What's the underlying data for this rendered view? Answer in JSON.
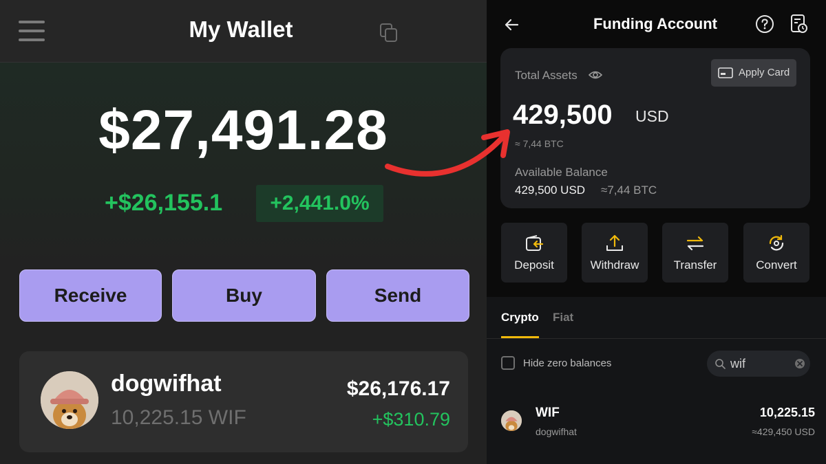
{
  "left_app": {
    "title": "My Wallet",
    "balance": "$27,491.28",
    "gain_amount": "+$26,155.1",
    "gain_percent": "+2,441.0%",
    "buttons": {
      "receive": "Receive",
      "buy": "Buy",
      "send": "Send"
    },
    "token": {
      "name": "dogwifhat",
      "amount": "10,225.15 WIF",
      "usd_value": "$26,176.17",
      "change": "+$310.79"
    }
  },
  "right_app": {
    "title": "Funding Account",
    "total_assets_label": "Total Assets",
    "apply_card_label": "Apply Card",
    "total_amount": "429,500",
    "total_unit": "USD",
    "btc_approx": "≈ 7,44 BTC",
    "available_label": "Available Balance",
    "available_usd": "429,500 USD",
    "available_btc": "≈7,44 BTC",
    "actions": {
      "deposit": "Deposit",
      "withdraw": "Withdraw",
      "transfer": "Transfer",
      "convert": "Convert"
    },
    "tabs": {
      "crypto": "Crypto",
      "fiat": "Fiat"
    },
    "hide_zero_label": "Hide zero balances",
    "search_value": "wif",
    "coin": {
      "symbol": "WIF",
      "name": "dogwifhat",
      "amount": "10,225.15",
      "usd_value": "≈429,450 USD"
    }
  },
  "colors": {
    "gain_green": "#23c35e",
    "button_purple": "#a99cf0",
    "accent_yellow": "#f0b90b",
    "arrow_red": "#e8312f"
  }
}
